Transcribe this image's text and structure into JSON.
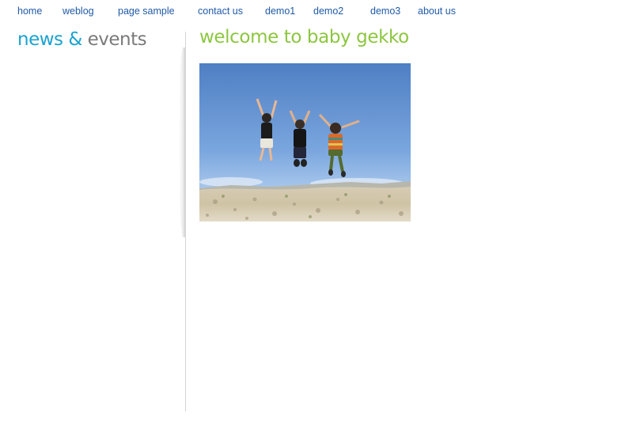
{
  "nav": {
    "items": [
      {
        "label": "home"
      },
      {
        "label": "weblog"
      },
      {
        "label": "page sample"
      },
      {
        "label": "contact us"
      },
      {
        "label": "demo1"
      },
      {
        "label": "demo2"
      },
      {
        "label": "demo3"
      },
      {
        "label": "about us"
      }
    ]
  },
  "sidebar": {
    "title_part1": "news",
    "title_amp": "&",
    "title_part2": "events"
  },
  "main": {
    "title": "welcome to baby gekko"
  },
  "colors": {
    "nav_link": "#1f5aa6",
    "sidebar_accent": "#1aa3cf",
    "sidebar_gray": "#7a7a7a",
    "main_title": "#8cc63f"
  }
}
